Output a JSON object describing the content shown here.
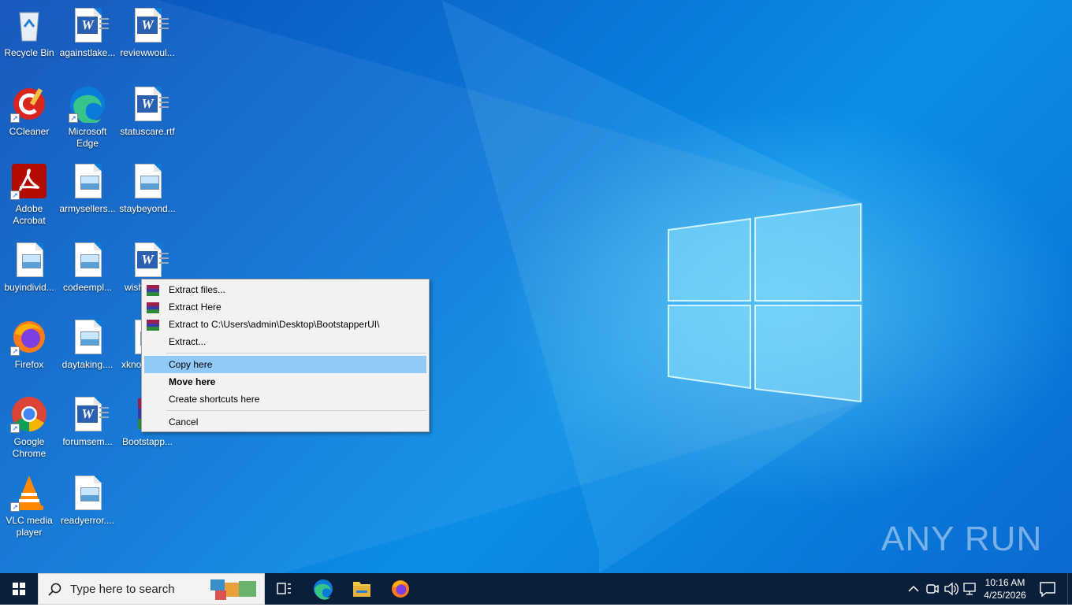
{
  "desktop": {
    "icons": [
      {
        "label": "Recycle Bin"
      },
      {
        "label": "againstlake..."
      },
      {
        "label": "reviewwoul..."
      },
      {
        "label": "CCleaner"
      },
      {
        "label": "Microsoft Edge"
      },
      {
        "label": "statuscare.rtf"
      },
      {
        "label": "Adobe Acrobat"
      },
      {
        "label": "armysellers..."
      },
      {
        "label": "staybeyond..."
      },
      {
        "label": "buyindivid..."
      },
      {
        "label": "codeempl..."
      },
      {
        "label": "wish"
      },
      {
        "label": "Firefox"
      },
      {
        "label": "daytaking...."
      },
      {
        "label": "xkno"
      },
      {
        "label": "Google Chrome"
      },
      {
        "label": "forumsem..."
      },
      {
        "label": "Bootstapp..."
      },
      {
        "label": "VLC media player"
      },
      {
        "label": "readyerror...."
      }
    ]
  },
  "context_menu": {
    "items": [
      {
        "label": "Extract files..."
      },
      {
        "label": "Extract Here"
      },
      {
        "label": "Extract to C:\\Users\\admin\\Desktop\\BootstapperUI\\"
      },
      {
        "label": "Extract..."
      },
      {
        "label": "Copy here"
      },
      {
        "label": "Move here"
      },
      {
        "label": "Create shortcuts here"
      },
      {
        "label": "Cancel"
      }
    ]
  },
  "taskbar": {
    "search_placeholder": "Type here to search",
    "time": "10:16 AM",
    "date": "4/25/2026"
  },
  "watermark": "ANY RUN",
  "colors": {
    "taskbar": "#0b1e3a",
    "menu_highlight": "#91c9f7",
    "desktop_blue": "#0a78d8"
  }
}
